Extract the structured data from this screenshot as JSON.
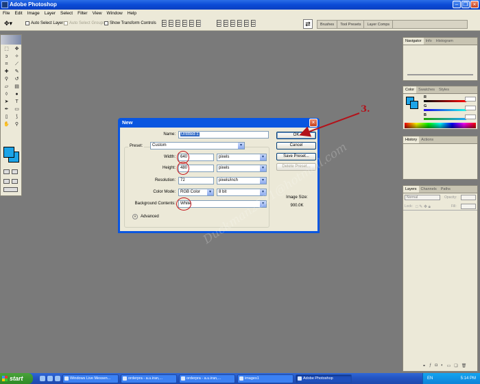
{
  "app": {
    "title": "Adobe Photoshop"
  },
  "menu": [
    "File",
    "Edit",
    "Image",
    "Layer",
    "Select",
    "Filter",
    "View",
    "Window",
    "Help"
  ],
  "options_bar": {
    "auto_select_layer": "Auto Select Layer",
    "auto_select_groups": "Auto Select Groups",
    "show_transform": "Show Transform Controls",
    "well_tabs": [
      "Brushes",
      "Tool Presets",
      "Layer Comps"
    ]
  },
  "palettes": {
    "navigator_tabs": [
      "Navigator",
      "Info",
      "Histogram"
    ],
    "color_tabs": [
      "Color",
      "Swatches",
      "Styles"
    ],
    "color_channels": [
      {
        "label": "R",
        "value": ""
      },
      {
        "label": "G",
        "value": ""
      },
      {
        "label": "B",
        "value": ""
      }
    ],
    "history_tabs": [
      "History",
      "Actions"
    ],
    "layers_tabs": [
      "Layers",
      "Channels",
      "Paths"
    ],
    "blend_mode": "Normal",
    "opacity_label": "Opacity:",
    "lock_label": "Lock:",
    "fill_label": "Fill:"
  },
  "dialog": {
    "title": "New",
    "name_label": "Name:",
    "name_value": "Untitled-1",
    "preset_label": "Preset:",
    "preset_value": "Custom",
    "width_label": "Width:",
    "width_value": "640",
    "width_unit": "pixels",
    "height_label": "Height:",
    "height_value": "480",
    "height_unit": "pixels",
    "resolution_label": "Resolution:",
    "resolution_value": "72",
    "resolution_unit": "pixels/inch",
    "color_mode_label": "Color Mode:",
    "color_mode_value": "RGB Color",
    "bit_depth": "8 bit",
    "bg_label": "Background Contents:",
    "bg_value": "White",
    "advanced_label": "Advanced",
    "buttons": {
      "ok": "OK",
      "cancel": "Cancel",
      "save_preset": "Save Preset...",
      "delete_preset": "Delete Preset..."
    },
    "image_size_label": "Image Size:",
    "image_size_value": "900.0K"
  },
  "annotation": {
    "step": "3.",
    "watermark": "Duckman2521@hotmail.com"
  },
  "taskbar": {
    "start": "start",
    "tasks": [
      "Windows Live Messen...",
      "orderpra - a.u.iran,...",
      "orderpra - a.u.iran,...",
      "images1",
      "Adobe Photoshop"
    ],
    "lang": "EN",
    "clock": "5:14 PM"
  },
  "colors": {
    "foreground": "#1ca4e8",
    "annotation_red": "#c4121a",
    "xp_blue": "#0a56e0"
  }
}
